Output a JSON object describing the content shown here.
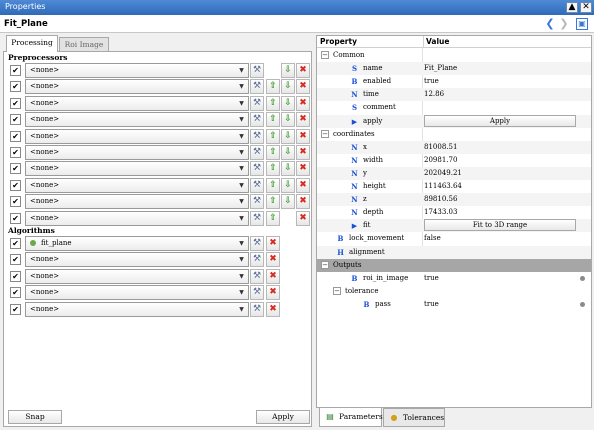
{
  "window": {
    "title": "Properties",
    "pin_glyph": "▲",
    "close_glyph": "✕"
  },
  "header": {
    "title": "Fit_Plane",
    "back_glyph": "❮",
    "forward_glyph": "❯",
    "panel_glyph": "▣"
  },
  "left": {
    "tabs": [
      {
        "label": "Processing",
        "active": true
      },
      {
        "label": "Roi Image",
        "active": false
      }
    ],
    "preprocessors_label": "Preprocessors",
    "preprocessors": [
      {
        "checked": true,
        "value": "<none>",
        "up": false,
        "down": true,
        "del": true
      },
      {
        "checked": true,
        "value": "<none>",
        "up": true,
        "down": true,
        "del": true
      },
      {
        "checked": true,
        "value": "<none>",
        "up": true,
        "down": true,
        "del": true
      },
      {
        "checked": true,
        "value": "<none>",
        "up": true,
        "down": true,
        "del": true
      },
      {
        "checked": true,
        "value": "<none>",
        "up": true,
        "down": true,
        "del": true
      },
      {
        "checked": true,
        "value": "<none>",
        "up": true,
        "down": true,
        "del": true
      },
      {
        "checked": true,
        "value": "<none>",
        "up": true,
        "down": true,
        "del": true
      },
      {
        "checked": true,
        "value": "<none>",
        "up": true,
        "down": true,
        "del": true
      },
      {
        "checked": true,
        "value": "<none>",
        "up": true,
        "down": true,
        "del": true
      },
      {
        "checked": true,
        "value": "<none>",
        "up": true,
        "down": false,
        "del": true
      }
    ],
    "algorithms_label": "Algorithms",
    "algorithms": [
      {
        "checked": true,
        "value": "fit_plane",
        "dot": true
      },
      {
        "checked": true,
        "value": "<none>",
        "dot": false
      },
      {
        "checked": true,
        "value": "<none>",
        "dot": false
      },
      {
        "checked": true,
        "value": "<none>",
        "dot": false
      },
      {
        "checked": true,
        "value": "<none>",
        "dot": false
      }
    ],
    "check_glyph": "✔",
    "arrow_glyph": "▼",
    "wrench_glyph": "⚒",
    "up_glyph": "⇧",
    "down_glyph": "⇩",
    "del_glyph": "✖",
    "snap_label": "Snap",
    "apply_label": "Apply"
  },
  "properties": {
    "col_property": "Property",
    "col_value": "Value",
    "rows": [
      {
        "level": 0,
        "expander": "−",
        "icon": "",
        "label": "Common",
        "value": "",
        "type": "group"
      },
      {
        "level": 1,
        "icon": "S",
        "label": "name",
        "value": "Fit_Plane",
        "type": "text",
        "alt": true
      },
      {
        "level": 1,
        "icon": "B",
        "label": "enabled",
        "value": "true",
        "type": "text"
      },
      {
        "level": 1,
        "icon": "N",
        "label": "time",
        "value": "12.86",
        "type": "text",
        "alt": true
      },
      {
        "level": 1,
        "icon": "S",
        "label": "comment",
        "value": "",
        "type": "text"
      },
      {
        "level": 1,
        "icon": "▶",
        "label": "apply",
        "value": "Apply",
        "type": "button",
        "alt": true
      },
      {
        "level": 0,
        "expander": "−",
        "icon": "",
        "label": "coordinates",
        "value": "",
        "type": "group"
      },
      {
        "level": 1,
        "icon": "N",
        "label": "x",
        "value": "81008.51",
        "type": "text",
        "alt": true
      },
      {
        "level": 1,
        "icon": "N",
        "label": "width",
        "value": "20981.70",
        "type": "text"
      },
      {
        "level": 1,
        "icon": "N",
        "label": "y",
        "value": "202049.21",
        "type": "text",
        "alt": true
      },
      {
        "level": 1,
        "icon": "N",
        "label": "height",
        "value": "111463.64",
        "type": "text"
      },
      {
        "level": 1,
        "icon": "N",
        "label": "z",
        "value": "89810.56",
        "type": "text",
        "alt": true
      },
      {
        "level": 1,
        "icon": "N",
        "label": "depth",
        "value": "17433.03",
        "type": "text"
      },
      {
        "level": 1,
        "icon": "▶",
        "label": "fit",
        "value": "Fit to 3D range",
        "type": "button",
        "alt": true
      },
      {
        "level": 0,
        "icon": "B",
        "label": "lock_movement",
        "value": "false",
        "type": "text"
      },
      {
        "level": 0,
        "icon": "H",
        "label": "alignment",
        "value": "",
        "type": "text",
        "alt": true
      },
      {
        "level": 0,
        "expander": "−",
        "icon": "",
        "label": "Outputs",
        "value": "",
        "type": "section"
      },
      {
        "level": 1,
        "icon": "B",
        "label": "roi_in_image",
        "value": "true",
        "type": "text",
        "bullet": true
      },
      {
        "level": 1,
        "expander": "−",
        "icon": "",
        "label": "tolerance",
        "value": "",
        "type": "group"
      },
      {
        "level": 2,
        "icon": "B",
        "label": "pass",
        "value": "true",
        "type": "text",
        "bullet": true
      }
    ]
  },
  "bottom_tabs": [
    {
      "label": "Parameters",
      "icon": "▤",
      "active": true
    },
    {
      "label": "Tolerances",
      "icon": "●",
      "active": false
    }
  ],
  "colors": {
    "title_bar": "#2e6ab8",
    "arrow_green": "#3c9a2c",
    "delete_red": "#d62b1f",
    "outputs_bg": "#a6a6a6",
    "type_icon_blue": "#1a4fd6"
  }
}
